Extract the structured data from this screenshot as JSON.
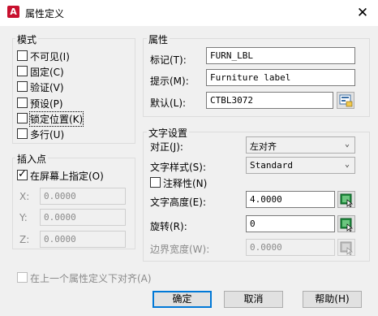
{
  "window": {
    "title": "属性定义",
    "app_icon_letter": "A",
    "close_glyph": "✕"
  },
  "mode": {
    "label": "模式",
    "options": [
      {
        "label": "不可见(I)",
        "checked": false
      },
      {
        "label": "固定(C)",
        "checked": false
      },
      {
        "label": "验证(V)",
        "checked": false
      },
      {
        "label": "预设(P)",
        "checked": false
      },
      {
        "label": "锁定位置(K)",
        "checked": false
      },
      {
        "label": "多行(U)",
        "checked": false
      }
    ]
  },
  "insertion": {
    "label": "插入点",
    "specify_on_screen": {
      "label": "在屏幕上指定(O)",
      "checked": true
    },
    "x": {
      "label": "X:",
      "value": "0.0000"
    },
    "y": {
      "label": "Y:",
      "value": "0.0000"
    },
    "z": {
      "label": "Z:",
      "value": "0.0000"
    }
  },
  "attribute": {
    "label": "属性",
    "tag": {
      "label": "标记(T):",
      "value": "FURN_LBL"
    },
    "prompt": {
      "label": "提示(M):",
      "value": "Furniture label"
    },
    "default": {
      "label": "默认(L):",
      "value": "CTBL3072"
    }
  },
  "text_settings": {
    "label": "文字设置",
    "justification": {
      "label": "对正(J):",
      "value": "左对齐"
    },
    "text_style": {
      "label": "文字样式(S):",
      "value": "Standard"
    },
    "annotative": {
      "label": "注释性(N)",
      "checked": false
    },
    "text_height": {
      "label": "文字高度(E):",
      "value": "4.0000"
    },
    "rotation": {
      "label": "旋转(R):",
      "value": "0"
    },
    "boundary_width": {
      "label": "边界宽度(W):",
      "value": "0.0000"
    }
  },
  "align_below": {
    "label": "在上一个属性定义下对齐(A)",
    "checked": false
  },
  "buttons": {
    "ok": "确定",
    "cancel": "取消",
    "help": "帮助(H)"
  },
  "colors": {
    "accent": "#0078d7",
    "app_icon": "#c8102e",
    "pick_green": "#1e8a3c"
  }
}
